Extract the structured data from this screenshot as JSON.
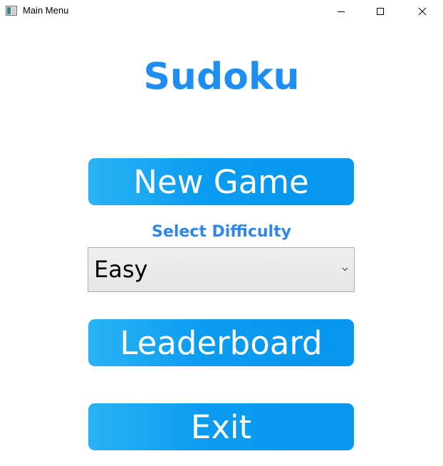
{
  "window": {
    "title": "Main Menu",
    "icon": "app-window-icon",
    "controls": [
      "minimize-icon",
      "maximize-icon",
      "close-icon"
    ]
  },
  "main": {
    "heading": "Sudoku",
    "new_game_label": "New Game",
    "difficulty_label": "Select Difficulty",
    "difficulty_selected": "Easy",
    "leaderboard_label": "Leaderboard",
    "exit_label": "Exit"
  },
  "colors": {
    "heading": "#1e8ff0",
    "button_gradient_start": "#2ab3f4",
    "button_gradient_end": "#0896f0",
    "difficulty_label": "#2f86e6",
    "button_text": "#ffffff"
  }
}
